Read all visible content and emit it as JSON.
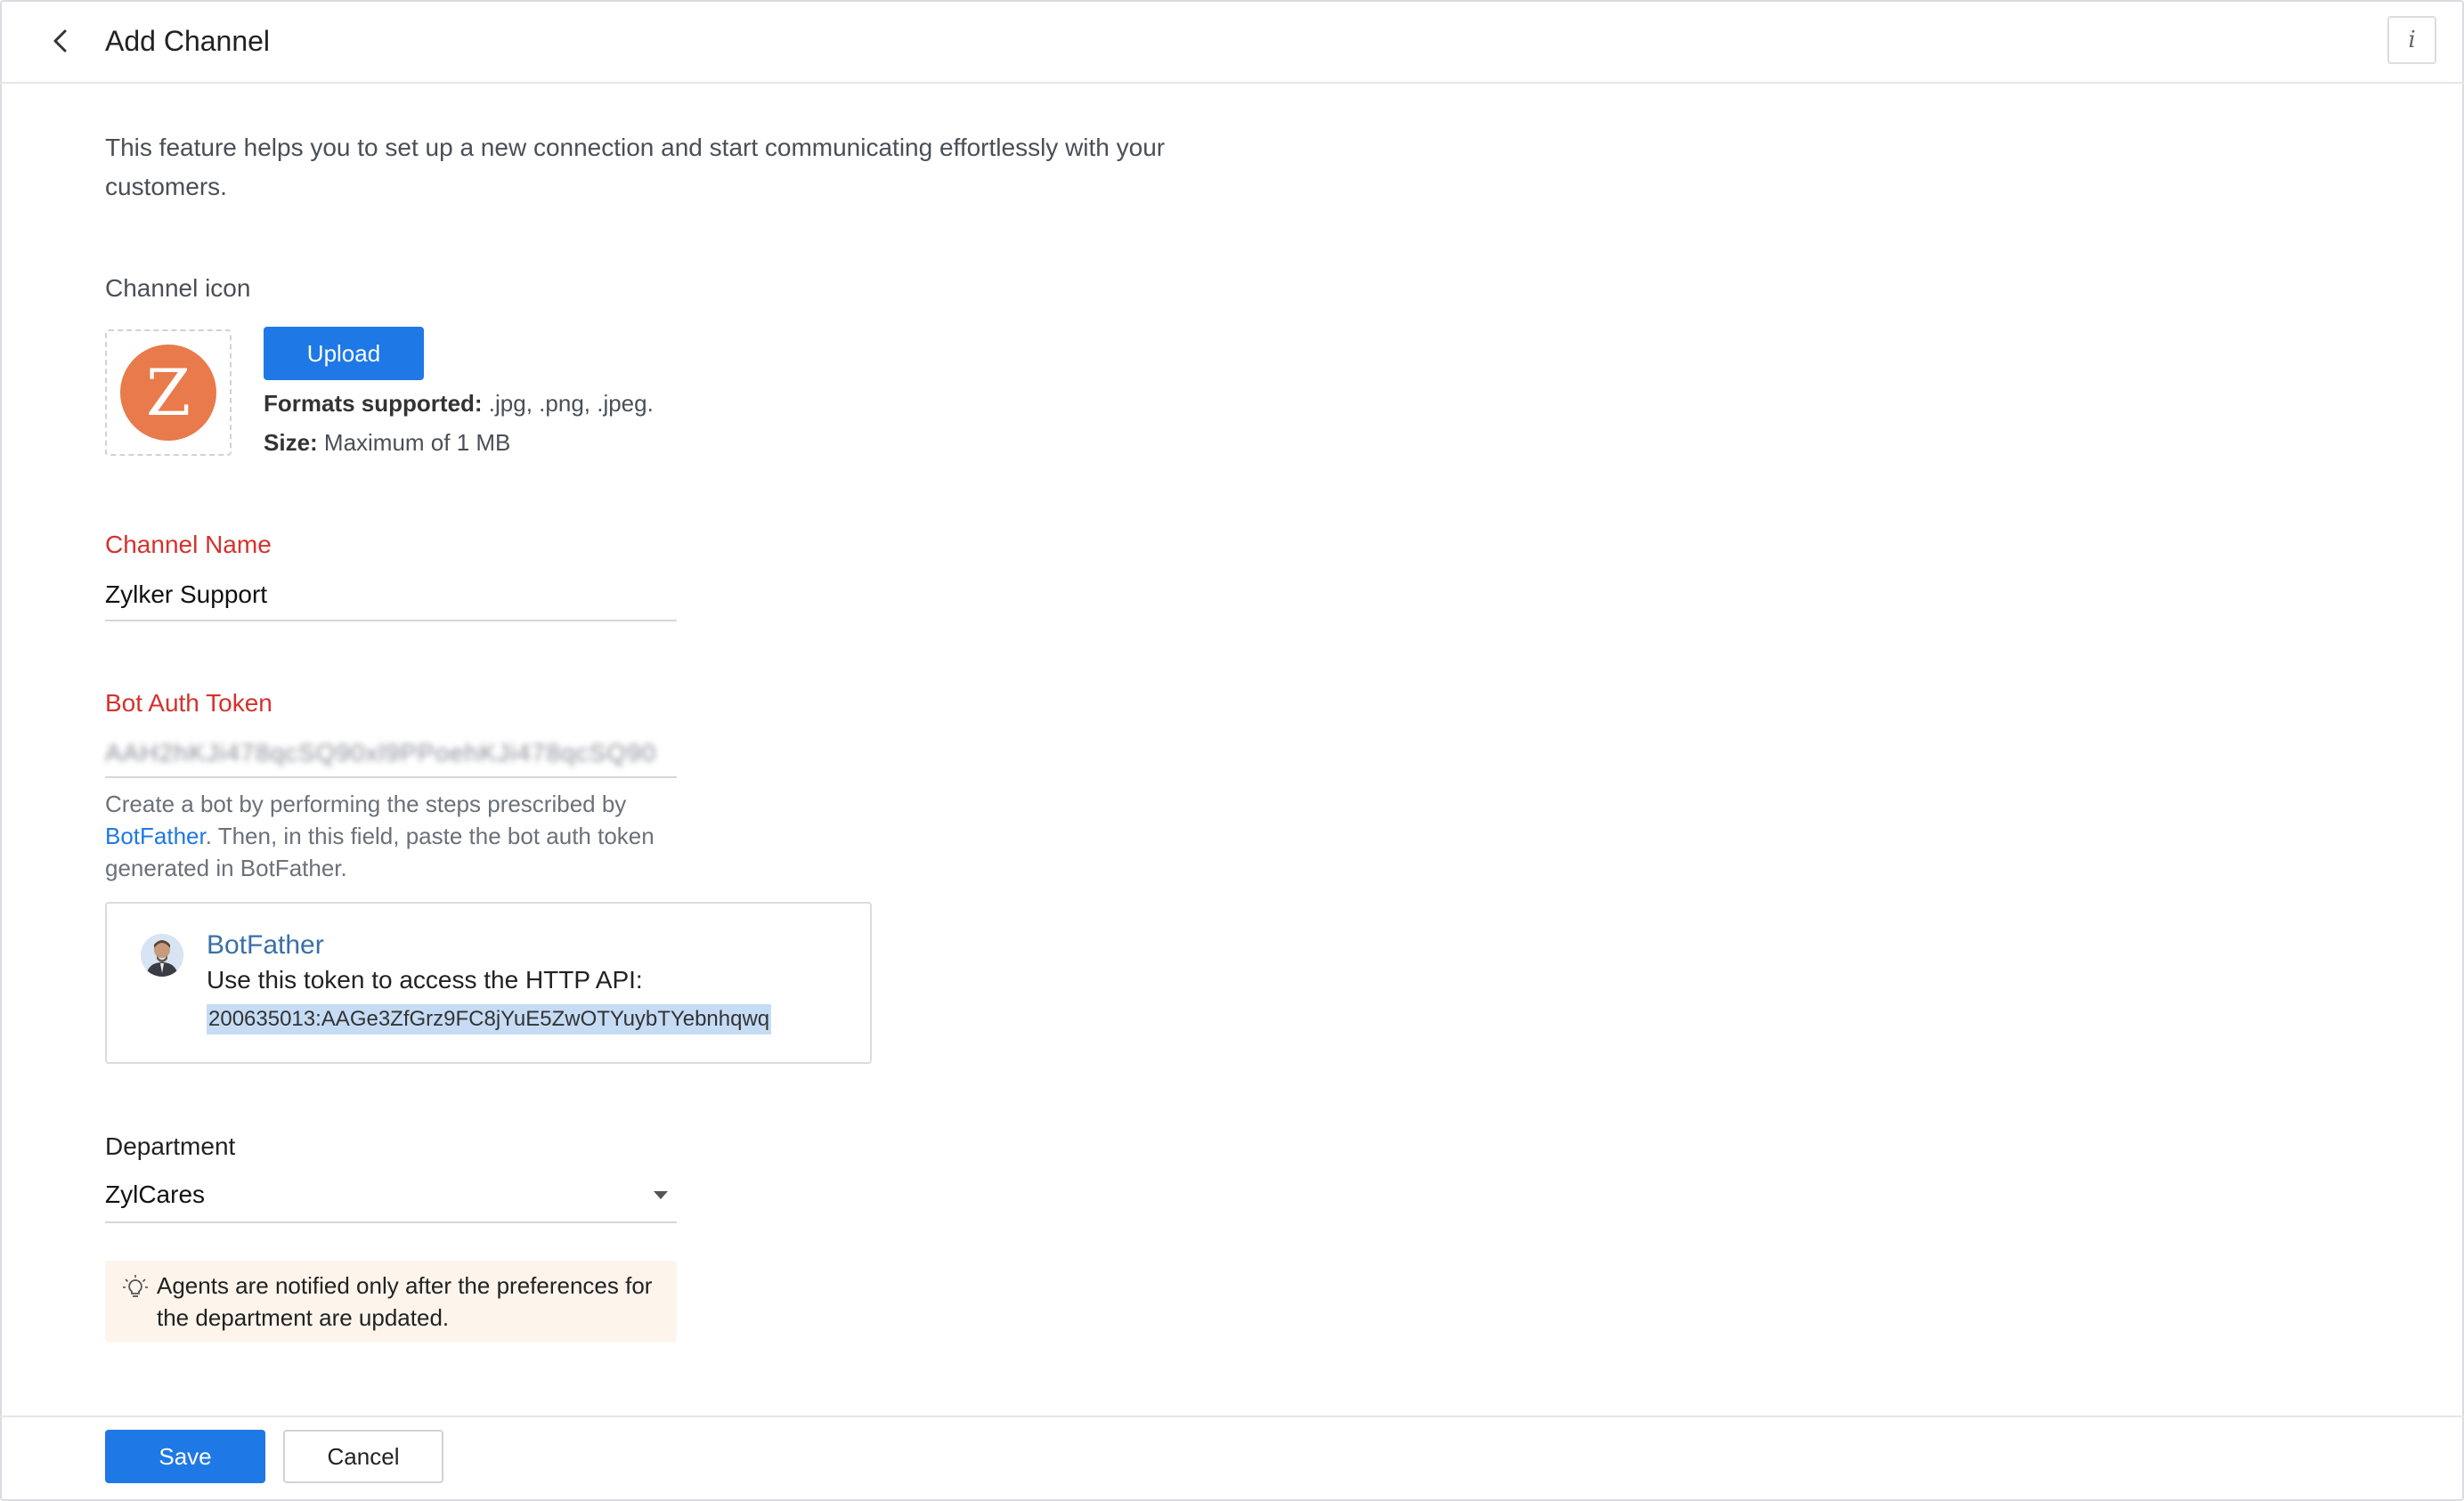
{
  "header": {
    "title": "Add Channel",
    "back_icon": "chevron-left-icon",
    "info_icon": "info-icon",
    "info_label": "i"
  },
  "description": "This feature helps you to set up a new connection and start communicating effortlessly with your customers.",
  "channel_icon": {
    "label": "Channel icon",
    "letter": "Z",
    "color": "#e97a4b",
    "upload_label": "Upload",
    "formats_key": "Formats supported:",
    "formats_value": " .jpg, .png, .jpeg.",
    "size_key": "Size:",
    "size_value": " Maximum of 1 MB"
  },
  "channel_name": {
    "label": "Channel Name",
    "value": "Zylker Support"
  },
  "bot_token": {
    "label": "Bot Auth Token",
    "value": "AAH2hKJi478qcSQ90xl9PPoehKJi478qcSQ90",
    "help_before": "Create a bot by performing the steps prescribed by ",
    "help_link": "BotFather",
    "help_after": ". Then, in this field, paste the bot auth token generated in BotFather."
  },
  "bot_card": {
    "name": "BotFather",
    "message": "Use this token to access the HTTP API:",
    "token": "200635013:AAGe3ZfGrz9FC8jYuE5ZwOTYuybTYebnhqwq"
  },
  "department": {
    "label": "Department",
    "value": "ZylCares",
    "note": "Agents are notified only after the preferences for the department are updated."
  },
  "footer": {
    "save_label": "Save",
    "cancel_label": "Cancel"
  },
  "colors": {
    "primary": "#1e78e6",
    "required": "#d5322d",
    "note_bg": "#fdf5ec"
  }
}
